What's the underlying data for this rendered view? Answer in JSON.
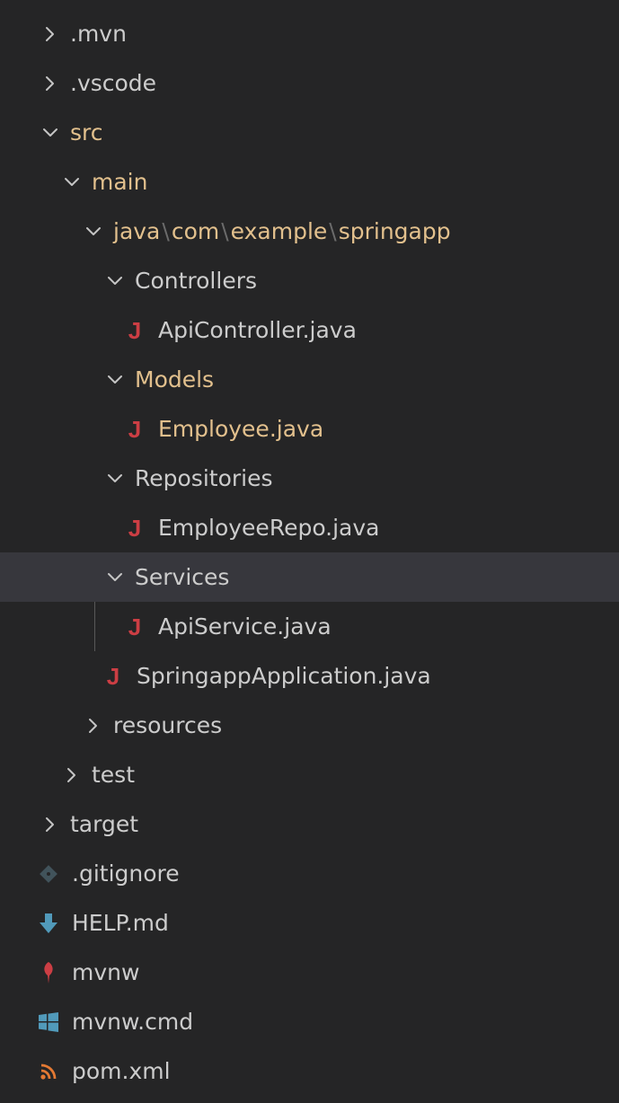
{
  "explorer": {
    "items": [
      {
        "label": ".mvn",
        "kind": "folder",
        "state": "collapsed",
        "depth": 0
      },
      {
        "label": ".vscode",
        "kind": "folder",
        "state": "collapsed",
        "depth": 0
      },
      {
        "label": "src",
        "kind": "folder",
        "state": "expanded",
        "depth": 0,
        "modified": true
      },
      {
        "label": "main",
        "kind": "folder",
        "state": "expanded",
        "depth": 1,
        "modified": true
      },
      {
        "label": "java\\com\\example\\springapp",
        "kind": "folder",
        "state": "expanded",
        "depth": 2,
        "modified": true,
        "segments": [
          "java",
          "com",
          "example",
          "springapp"
        ]
      },
      {
        "label": "Controllers",
        "kind": "folder",
        "state": "expanded",
        "depth": 3
      },
      {
        "label": "ApiController.java",
        "kind": "file",
        "icon": "java-icon",
        "depth": 4
      },
      {
        "label": "Models",
        "kind": "folder",
        "state": "expanded",
        "depth": 3,
        "modified": true
      },
      {
        "label": "Employee.java",
        "kind": "file",
        "icon": "java-icon",
        "depth": 4,
        "modified": true
      },
      {
        "label": "Repositories",
        "kind": "folder",
        "state": "expanded",
        "depth": 3
      },
      {
        "label": "EmployeeRepo.java",
        "kind": "file",
        "icon": "java-icon",
        "depth": 4
      },
      {
        "label": "Services",
        "kind": "folder",
        "state": "expanded",
        "depth": 3,
        "selected": true
      },
      {
        "label": "ApiService.java",
        "kind": "file",
        "icon": "java-icon",
        "depth": 4,
        "guide": true
      },
      {
        "label": "SpringappApplication.java",
        "kind": "file",
        "icon": "java-icon",
        "depth": 3
      },
      {
        "label": "resources",
        "kind": "folder",
        "state": "collapsed",
        "depth": 2
      },
      {
        "label": "test",
        "kind": "folder",
        "state": "collapsed",
        "depth": 1
      },
      {
        "label": "target",
        "kind": "folder",
        "state": "collapsed",
        "depth": 0
      },
      {
        "label": ".gitignore",
        "kind": "file",
        "icon": "git-diamond-icon",
        "depth": 0
      },
      {
        "label": "HELP.md",
        "kind": "file",
        "icon": "markdown-arrow-icon",
        "depth": 0
      },
      {
        "label": "mvnw",
        "kind": "file",
        "icon": "maven-feather-icon",
        "depth": 0
      },
      {
        "label": "mvnw.cmd",
        "kind": "file",
        "icon": "windows-icon",
        "depth": 0
      },
      {
        "label": "pom.xml",
        "kind": "file",
        "icon": "rss-feed-icon",
        "depth": 0
      }
    ]
  },
  "colors": {
    "background": "#252526",
    "text": "#cccccc",
    "modified": "#e2c08d",
    "selection": "#37373d",
    "java": "#cc3e44",
    "markdown": "#519aba",
    "windows": "#519aba",
    "maven": "#cc3e44",
    "xml": "#e37933",
    "git": "#41535b"
  }
}
